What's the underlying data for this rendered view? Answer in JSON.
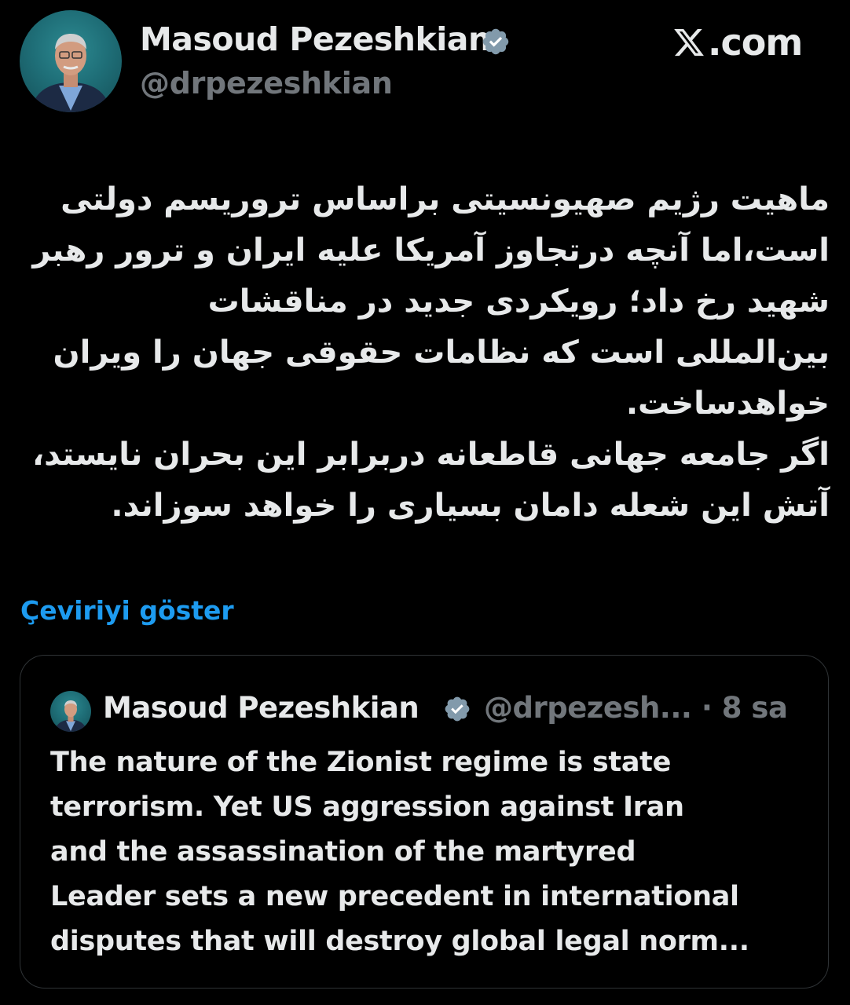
{
  "post": {
    "author_name": "Masoud Pezeshkian",
    "author_handle": "@drpezeshkian",
    "site": ".com",
    "body_fa": "ماهیت رژیم صهیونسیتی براساس تروریسم دولتی\nاست،اما آنچه درتجاوز آمریکا علیه ایران و ترور رهبر\nشهید رخ داد؛ رویکردی جدید در مناقشات\nبین‌المللی است که نظامات حقوقی جهان را ویران\nخواهدساخت.\nاگر جامعه جهانی قاطعانه دربرابر این بحران نایستد،\nآتش این شعله دامان بسیاری را خواهد سوزاند.",
    "translate_link": "Çeviriyi göster"
  },
  "quote": {
    "author_name": "Masoud Pezeshkian",
    "handle_time": "@drpezesh... · 8 sa",
    "body": "The nature of the Zionist regime is state\nterrorism. Yet US aggression against Iran\nand the assassination of the martyred\nLeader sets a new precedent in international\ndisputes that will destroy global legal norm..."
  },
  "colors": {
    "background": "#000000",
    "text": "#e7e9ea",
    "muted": "#71767b",
    "link": "#1d9bf0",
    "border": "#2f3336"
  }
}
